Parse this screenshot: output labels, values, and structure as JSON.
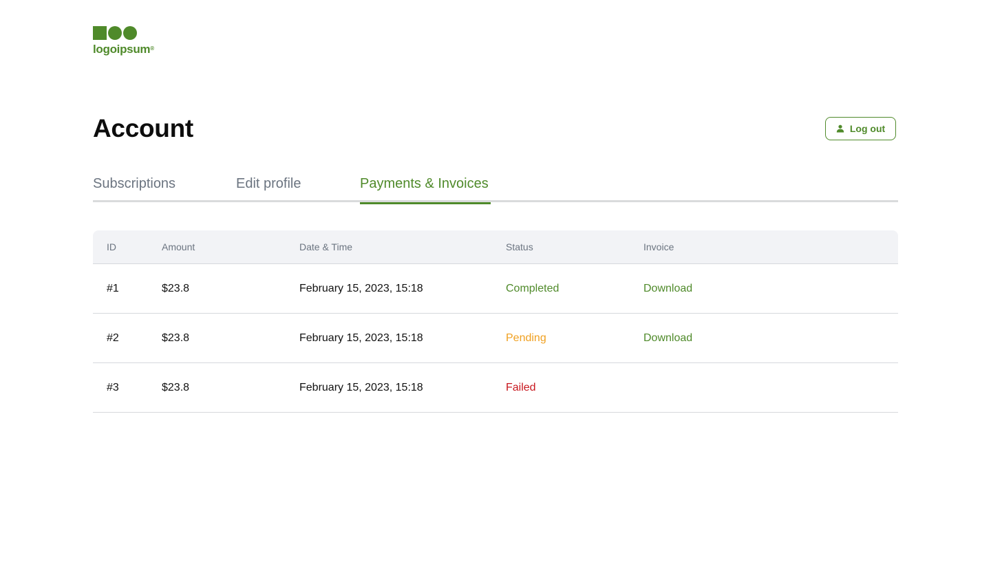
{
  "brand": {
    "logo_text": "logoipsum",
    "logo_mark": "®",
    "accent_color": "#4f8a2a"
  },
  "header": {
    "title": "Account",
    "logout_label": "Log out",
    "logout_icon": "user-icon"
  },
  "tabs": [
    {
      "label": "Subscriptions",
      "active": false
    },
    {
      "label": "Edit profile",
      "active": false
    },
    {
      "label": "Payments & Invoices",
      "active": true
    }
  ],
  "table": {
    "columns": {
      "id": "ID",
      "amount": "Amount",
      "date": "Date & Time",
      "status": "Status",
      "invoice": "Invoice"
    },
    "rows": [
      {
        "id": "#1",
        "amount": "$23.8",
        "date": "February 15, 2023, 15:18",
        "status": "Completed",
        "status_color": "#4f8a2a",
        "invoice": "Download"
      },
      {
        "id": "#2",
        "amount": "$23.8",
        "date": "February 15, 2023, 15:18",
        "status": "Pending",
        "status_color": "#f0a020",
        "invoice": "Download"
      },
      {
        "id": "#3",
        "amount": "$23.8",
        "date": "February 15, 2023, 15:18",
        "status": "Failed",
        "status_color": "#c8171e",
        "invoice": ""
      }
    ]
  }
}
